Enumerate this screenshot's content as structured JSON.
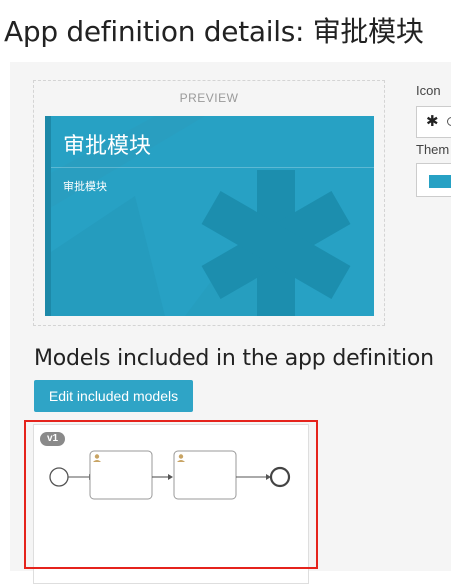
{
  "page": {
    "title": "App definition details: 审批模块"
  },
  "preview": {
    "label": "PREVIEW",
    "tile": {
      "name": "审批模块",
      "description": "审批模块",
      "theme_color": "#27a1c4",
      "icon": "asterisk-icon"
    }
  },
  "settings": {
    "icon_label": "Icon",
    "icon_value": "✱",
    "theme_label": "Them",
    "theme_color": "#27a1c4"
  },
  "models": {
    "title": "Models included in the app definition",
    "edit_button_label": "Edit included models",
    "items": [
      {
        "version": "v1",
        "diagram_elements": [
          "start-event",
          "user-task",
          "user-task",
          "end-event"
        ]
      }
    ]
  },
  "colors": {
    "accent": "#2fa4c6",
    "highlight": "#e5231c"
  }
}
